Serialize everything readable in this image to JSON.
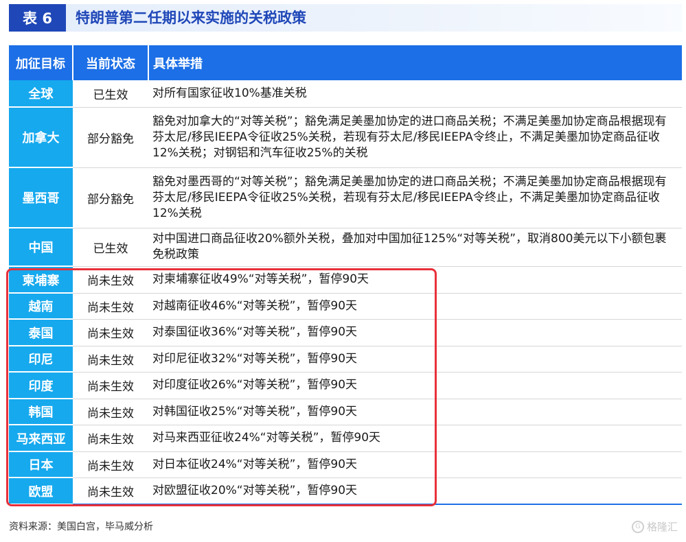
{
  "header": {
    "badge": "表 6",
    "title": "特朗普第二任期以来实施的关税政策"
  },
  "table": {
    "columns": [
      "加征目标",
      "当前状态",
      "具体举措"
    ],
    "rows": [
      {
        "target": "全球",
        "status": "已生效",
        "measure": "对所有国家征收10%基准关税",
        "h": 39
      },
      {
        "target": "加拿大",
        "status": "部分豁免",
        "measure": "豁免对加拿大的“对等关税”；豁免满足美墨加协定的进口商品关税；不满足美墨加协定商品根据现有芬太尼/移民IEEPA令征收25%关税，若现有芬太尼/移民IEEPA令终止，不满足美墨加协定商品征收12%关税；对钢铝和汽车征收25%的关税",
        "h": 88
      },
      {
        "target": "墨西哥",
        "status": "部分豁免",
        "measure": "豁免对墨西哥的“对等关税”；豁免满足美墨加协定的进口商品关税；不满足美墨加协定商品根据现有芬太尼/移民IEEPA令征收25%关税，若现有芬太尼/移民IEEPA令终止，不满足美墨加协定商品征收12%关税",
        "h": 88
      },
      {
        "target": "中国",
        "status": "已生效",
        "measure": "对中国进口商品征收20%额外关税，叠加对中国加征125%“对等关税”，取消800美元以下小额包裹免税政策",
        "h": 56
      },
      {
        "target": "柬埔寨",
        "status": "尚未生效",
        "measure": "对柬埔寨征收49%“对等关税”，暂停90天",
        "h": 39
      },
      {
        "target": "越南",
        "status": "尚未生效",
        "measure": "对越南征收46%“对等关税”，暂停90天",
        "h": 38
      },
      {
        "target": "泰国",
        "status": "尚未生效",
        "measure": "对泰国征收36%“对等关税”，暂停90天",
        "h": 39
      },
      {
        "target": "印尼",
        "status": "尚未生效",
        "measure": "对印尼征收32%“对等关税”，暂停90天",
        "h": 38
      },
      {
        "target": "印度",
        "status": "尚未生效",
        "measure": "对印度征收26%“对等关税”，暂停90天",
        "h": 39
      },
      {
        "target": "韩国",
        "status": "尚未生效",
        "measure": "对韩国征收25%“对等关税”，暂停90天",
        "h": 38
      },
      {
        "target": "马来西亚",
        "status": "尚未生效",
        "measure": "对马来西亚征收24%“对等关税”，暂停90天",
        "h": 39
      },
      {
        "target": "日本",
        "status": "尚未生效",
        "measure": "对日本征收24%“对等关税”，暂停90天",
        "h": 38
      },
      {
        "target": "欧盟",
        "status": "尚未生效",
        "measure": "对欧盟征收20%“对等关税”，暂停90天",
        "h": 39
      }
    ]
  },
  "footer": {
    "source": "资料来源：美国白宫，毕马威分析",
    "watermark": "格隆汇"
  },
  "colors": {
    "title_blue": "#1f47b8",
    "header_blue": "#1c6fe6",
    "target_cyan": "#16a9ee",
    "highlight_red": "#e8303a"
  }
}
